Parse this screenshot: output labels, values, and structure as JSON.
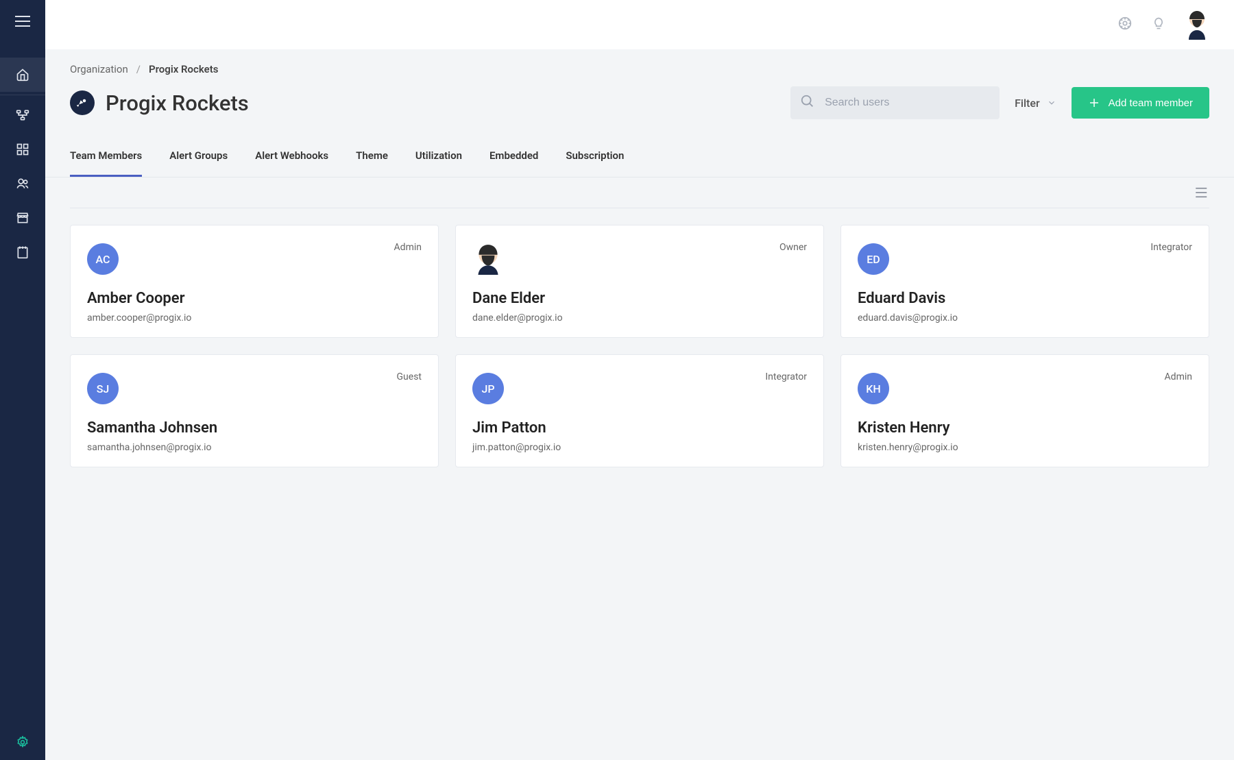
{
  "breadcrumb": {
    "root": "Organization",
    "current": "Progix Rockets"
  },
  "page": {
    "title": "Progix Rockets"
  },
  "search": {
    "placeholder": "Search users"
  },
  "filter": {
    "label": "Filter"
  },
  "actions": {
    "add_member": "Add team member"
  },
  "tabs": [
    {
      "label": "Team Members",
      "active": true
    },
    {
      "label": "Alert Groups",
      "active": false
    },
    {
      "label": "Alert Webhooks",
      "active": false
    },
    {
      "label": "Theme",
      "active": false
    },
    {
      "label": "Utilization",
      "active": false
    },
    {
      "label": "Embedded",
      "active": false
    },
    {
      "label": "Subscription",
      "active": false
    }
  ],
  "members": [
    {
      "initials": "AC",
      "name": "Amber Cooper",
      "email": "amber.cooper@progix.io",
      "role": "Admin",
      "avatar": "initials"
    },
    {
      "initials": "",
      "name": "Dane Elder",
      "email": "dane.elder@progix.io",
      "role": "Owner",
      "avatar": "image"
    },
    {
      "initials": "ED",
      "name": "Eduard Davis",
      "email": "eduard.davis@progix.io",
      "role": "Integrator",
      "avatar": "initials"
    },
    {
      "initials": "SJ",
      "name": "Samantha Johnsen",
      "email": "samantha.johnsen@progix.io",
      "role": "Guest",
      "avatar": "initials"
    },
    {
      "initials": "JP",
      "name": "Jim Patton",
      "email": "jim.patton@progix.io",
      "role": "Integrator",
      "avatar": "initials"
    },
    {
      "initials": "KH",
      "name": "Kristen Henry",
      "email": "kristen.henry@progix.io",
      "role": "Admin",
      "avatar": "initials"
    }
  ]
}
